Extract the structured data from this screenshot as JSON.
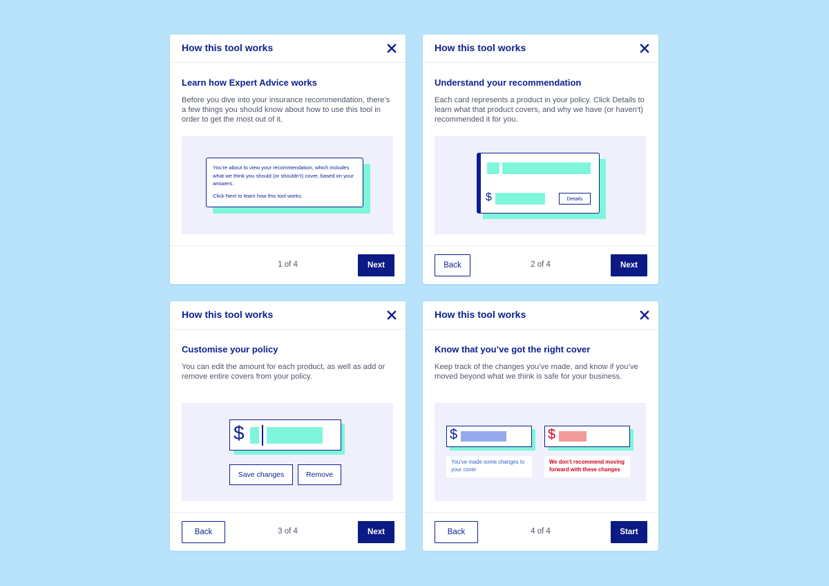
{
  "colors": {
    "background": "#b9e3fb",
    "navy": "#0b1f8f",
    "mint": "#7ff6dc",
    "illustration_bg": "#eff0fc",
    "blue_bar": "#97a9ee",
    "red": "#d0021b",
    "red_bar": "#f29b9b",
    "note_blue": "#2f62c9"
  },
  "modals": [
    {
      "header": {
        "title": "How this tool works",
        "close_icon": "close-icon"
      },
      "heading": "Learn how Expert Advice works",
      "body": "Before you dive into your insurance recommendation, there’s a few things you should know about how to use this tool in order to get the most out of it.",
      "illustration": {
        "line1": "You’re about to view your recommendation, which includes what we think you should (or shouldn’t) cover, based on your answers.",
        "line2": "Click Next to learn how this tool works."
      },
      "footer": {
        "counter": "1 of 4",
        "next": "Next"
      }
    },
    {
      "header": {
        "title": "How this tool works",
        "close_icon": "close-icon"
      },
      "heading": "Understand your recommendation",
      "body": "Each card represents a product in your policy. Click Details to learn what that product covers, and why we have (or haven't) recommended it for you.",
      "illustration": {
        "currency": "$",
        "details": "Details"
      },
      "footer": {
        "back": "Back",
        "counter": "2 of 4",
        "next": "Next"
      }
    },
    {
      "header": {
        "title": "How this tool works",
        "close_icon": "close-icon"
      },
      "heading": "Customise your policy",
      "body": "You can edit the amount for each product, as well as add or remove entire covers from your policy.",
      "illustration": {
        "currency": "$",
        "save": "Save changes",
        "remove": "Remove"
      },
      "footer": {
        "back": "Back",
        "counter": "3 of 4",
        "next": "Next"
      }
    },
    {
      "header": {
        "title": "How this tool works",
        "close_icon": "close-icon"
      },
      "heading": "Know that you’ve got the right cover",
      "body": "Keep track of the changes you’ve made, and know if you’ve moved beyond what we think is safe for your business.",
      "illustration": {
        "currency": "$",
        "note_ok": "You’ve made some changes to your cover",
        "note_warn": "We don’t recommend moving forward with these changes"
      },
      "footer": {
        "back": "Back",
        "counter": "4 of 4",
        "next": "Start"
      }
    }
  ]
}
